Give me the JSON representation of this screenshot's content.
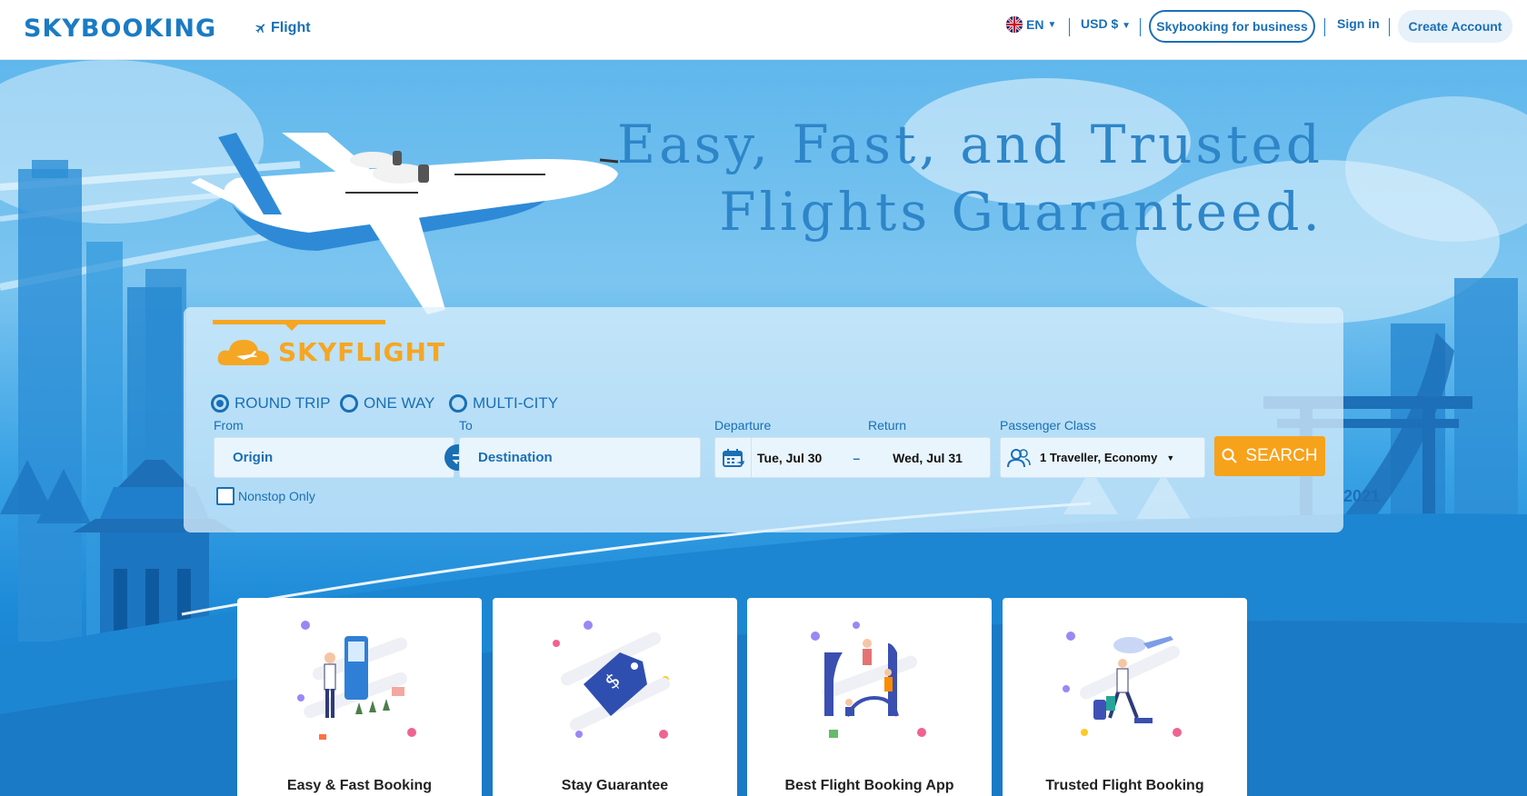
{
  "header": {
    "logo": "SKYBOOKING",
    "nav_flight": "Flight",
    "language": "EN",
    "currency": "USD $",
    "business_btn": "Skybooking for business",
    "signin": "Sign in",
    "create_account": "Create Account"
  },
  "hero": {
    "title_line1": "Easy, Fast, and Trusted",
    "title_line2": "Flights Guaranteed.",
    "watermark_year": "2021"
  },
  "search": {
    "brand": "SKYFLIGHT",
    "trip_types": [
      "ROUND TRIP",
      "ONE WAY",
      "MULTI-CITY"
    ],
    "selected_trip": "ROUND TRIP",
    "from_label": "From",
    "from_value": "Origin",
    "to_label": "To",
    "to_value": "Destination",
    "departure_label": "Departure",
    "departure_value": "Tue, Jul 30",
    "date_sep": "–",
    "return_label": "Return",
    "return_value": "Wed, Jul 31",
    "class_label": "Passenger Class",
    "class_value": "1 Traveller, Economy",
    "nonstop_label": "Nonstop Only",
    "search_btn": "SEARCH"
  },
  "features": [
    {
      "title": "Easy & Fast Booking"
    },
    {
      "title": "Stay Guarantee"
    },
    {
      "title": "Best Flight Booking App"
    },
    {
      "title": "Trusted Flight Booking"
    }
  ],
  "colors": {
    "brand_blue": "#1a6fb5",
    "accent_orange": "#f7a21b",
    "hero_sky": "#5fb7ec"
  }
}
